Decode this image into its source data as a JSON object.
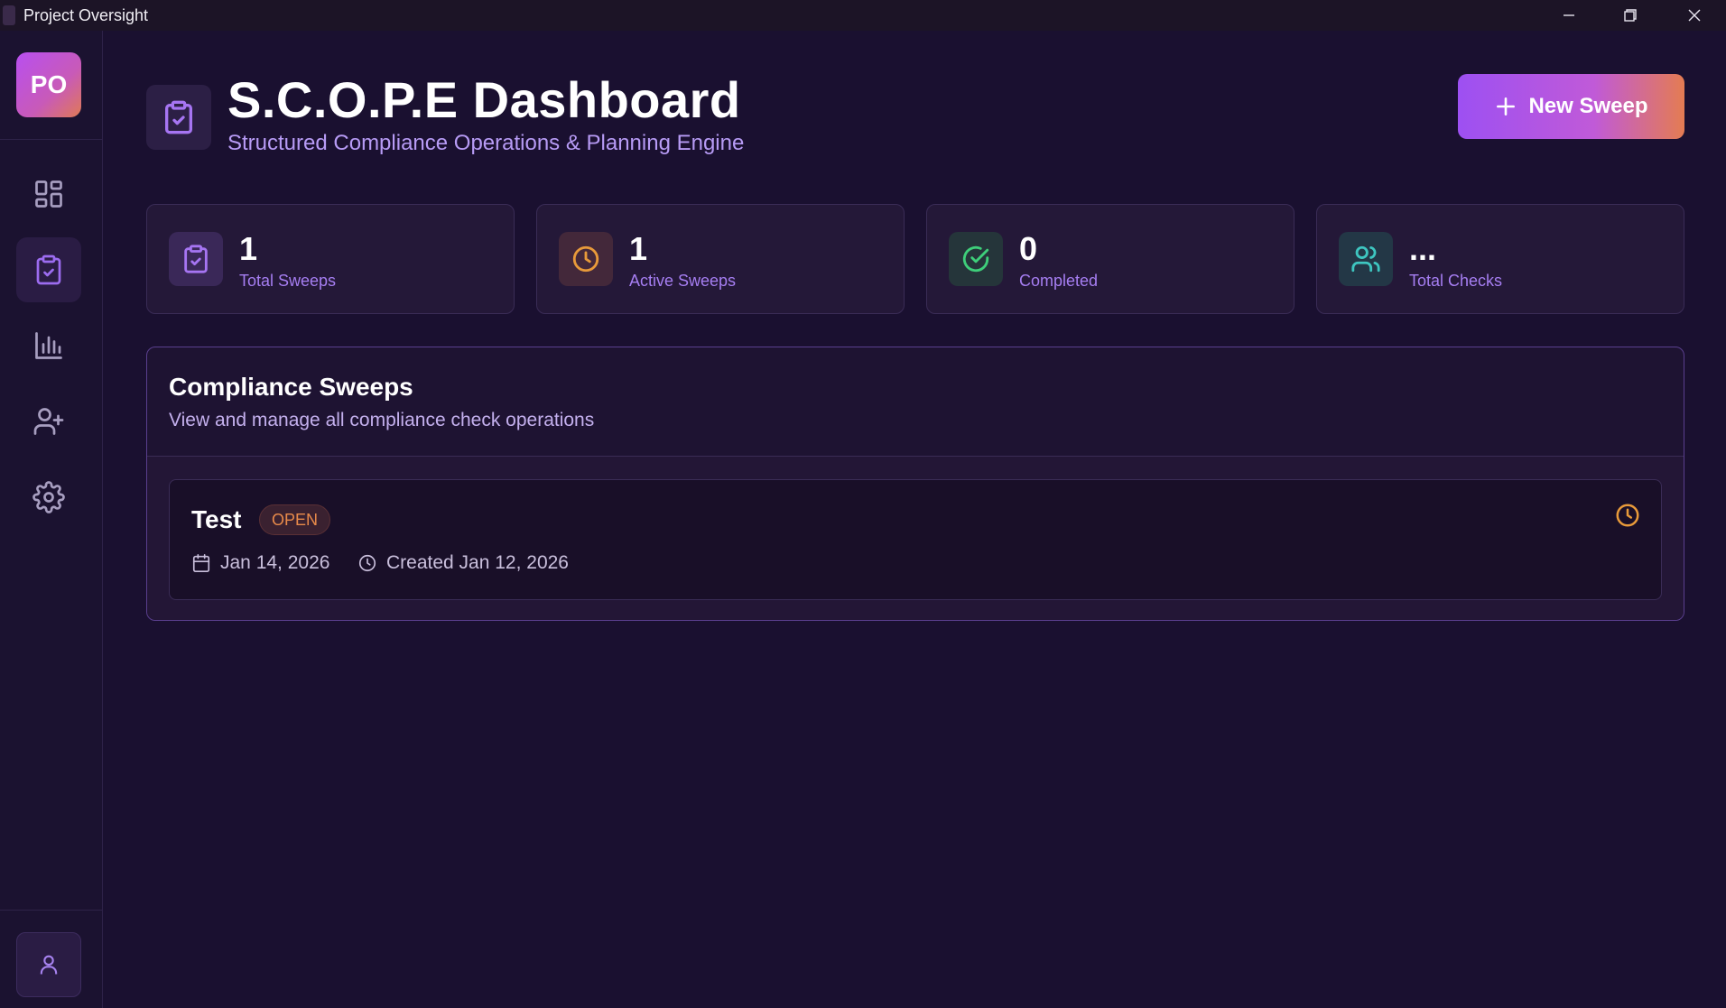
{
  "window": {
    "title": "Project Oversight",
    "controls": [
      "minimize",
      "restore",
      "close"
    ]
  },
  "sidebar": {
    "logo_text": "PO",
    "items": [
      {
        "icon": "dashboard-grid-icon",
        "active": false
      },
      {
        "icon": "clipboard-check-icon",
        "active": true
      },
      {
        "icon": "bar-chart-icon",
        "active": false
      },
      {
        "icon": "user-plus-icon",
        "active": false
      },
      {
        "icon": "gear-icon",
        "active": false
      }
    ],
    "profile_icon": "user-icon"
  },
  "header": {
    "title": "S.C.O.P.E Dashboard",
    "subtitle": "Structured Compliance Operations & Planning Engine",
    "new_sweep_label": "New Sweep"
  },
  "stats": [
    {
      "value": "1",
      "label": "Total Sweeps",
      "icon": "clipboard-check-icon",
      "color": "#a675f2"
    },
    {
      "value": "1",
      "label": "Active Sweeps",
      "icon": "clock-icon",
      "color": "#e89a3a"
    },
    {
      "value": "0",
      "label": "Completed",
      "icon": "check-circle-icon",
      "color": "#3ecf7a"
    },
    {
      "value": "...",
      "label": "Total Checks",
      "icon": "users-icon",
      "color": "#3ec6c0"
    }
  ],
  "compliance": {
    "title": "Compliance Sweeps",
    "subtitle": "View and manage all compliance check operations",
    "sweeps": [
      {
        "name": "Test",
        "status": "OPEN",
        "due_date": "Jan 14, 2026",
        "created": "Created Jan 12, 2026",
        "status_icon": "clock-icon"
      }
    ]
  }
}
